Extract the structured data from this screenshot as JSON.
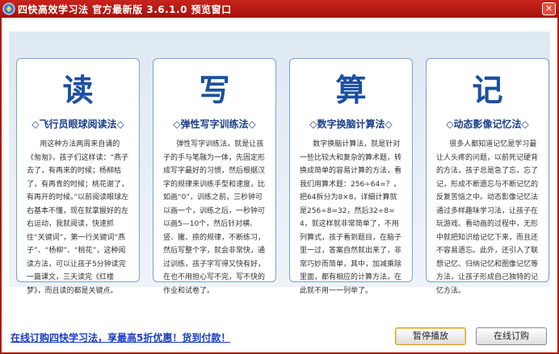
{
  "window": {
    "title": "四快高效学习法  官方最新版 3.6.1.0  预览窗口",
    "close_symbol": "✕"
  },
  "cards": [
    {
      "char": "读",
      "heading": "◇飞行员眼球阅读法◇",
      "body": "用这种方法两周来自诵的《匆匆》，孩子们这样读：“燕子去了，有再来的时候；杨柳枯了，有再青的时候；桃花谢了，有再开的时候。”以前阅读眼球左右基本不懂，现在就掌握好的左右运动，我就阅读，快速抓住“关键词”，第一行关键词“燕子”、“杨柳”、“桃花”，这种阅读方法，可以让孩子5分钟读完一篇课文，三天读完《红楼梦》，而且读的都是关键点。"
    },
    {
      "char": "写",
      "heading": "◇弹性写字训练法◇",
      "body": "弹性写字训练法，就是让孩子的手与笔融为一体，先固定形成写字最好的习惯，然后根据汉字的规律来训练手型和速度，比如画“0”，训练之前，三秒钟可以画一个，训练之后，一秒钟可以画5—10个，然后针对横、竖、撇、捺的规律，不断练习，然后写整个字，就会非常快，通过训练，孩子字写得又快有好，在也不用担心写不完，写不快的作业和试卷了。"
    },
    {
      "char": "算",
      "heading": "◇数字换脑计算法◇",
      "body": "数字换脑计算法，就是针对一些比较大和复杂的算术题，转换成简单的容易计算的方法，看我们用算术题：256÷64=？，把64拆分为8×8，详细计算就是256÷8=32，然后32÷8=4，就这样就非常简单了，不用列算式，孩子看到题目，在脑子里一过，答案自然就出来了，非常巧妙而简单，其中，加减乘除里面，都有相应的计算方法，在此就不用一一列举了。"
    },
    {
      "char": "记",
      "heading": "◇动态影像记忆法◇",
      "body": "很多人都知道记忆是学习最让人头疼的问题，以前死记硬背的方法，孩子总是急了忘，忘了记，形成不断遗忘与不断记忆的反复苦恼之中。动态影像记忆法通过多样趣味学习法，让孩子在玩游戏、看动画的过程中，无形中就把知识给记忆下来，而且还不容易遗忘。此外，还引入了联想记忆、归纳记忆和图像记忆等方法，让孩子形成自己独特的记忆方法。"
    }
  ],
  "footer": {
    "promo_link": "在线订购四快学习法，享最高5折优惠！货到付款！",
    "pause_button": "暂停播放",
    "order_button": "在线订购"
  }
}
